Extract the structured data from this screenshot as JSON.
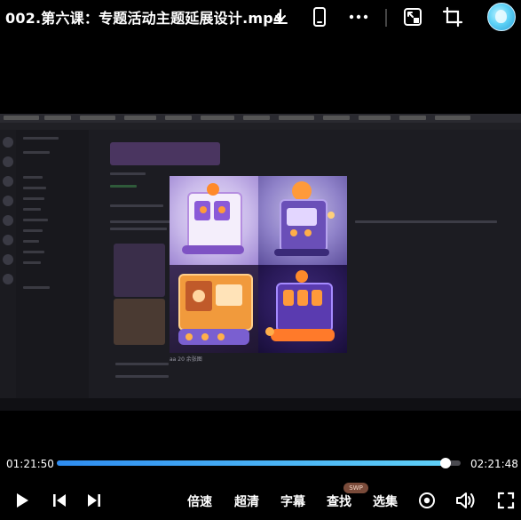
{
  "header": {
    "title": "002.第六课：专题活动主题延展设计.mp4"
  },
  "video": {
    "caption": "aa 20 余张图"
  },
  "player": {
    "current_time": "01:21:50",
    "total_time": "02:21:48",
    "progress": 0.962
  },
  "controls": {
    "speed_label": "倍速",
    "quality_label": "超清",
    "subtitle_label": "字幕",
    "search_label": "查找",
    "search_badge": "SWP",
    "select_label": "选集"
  },
  "colors": {
    "progress_start": "#2e8cf0",
    "progress_end": "#5fd0f7",
    "badge_bg": "#7a4b3a"
  }
}
